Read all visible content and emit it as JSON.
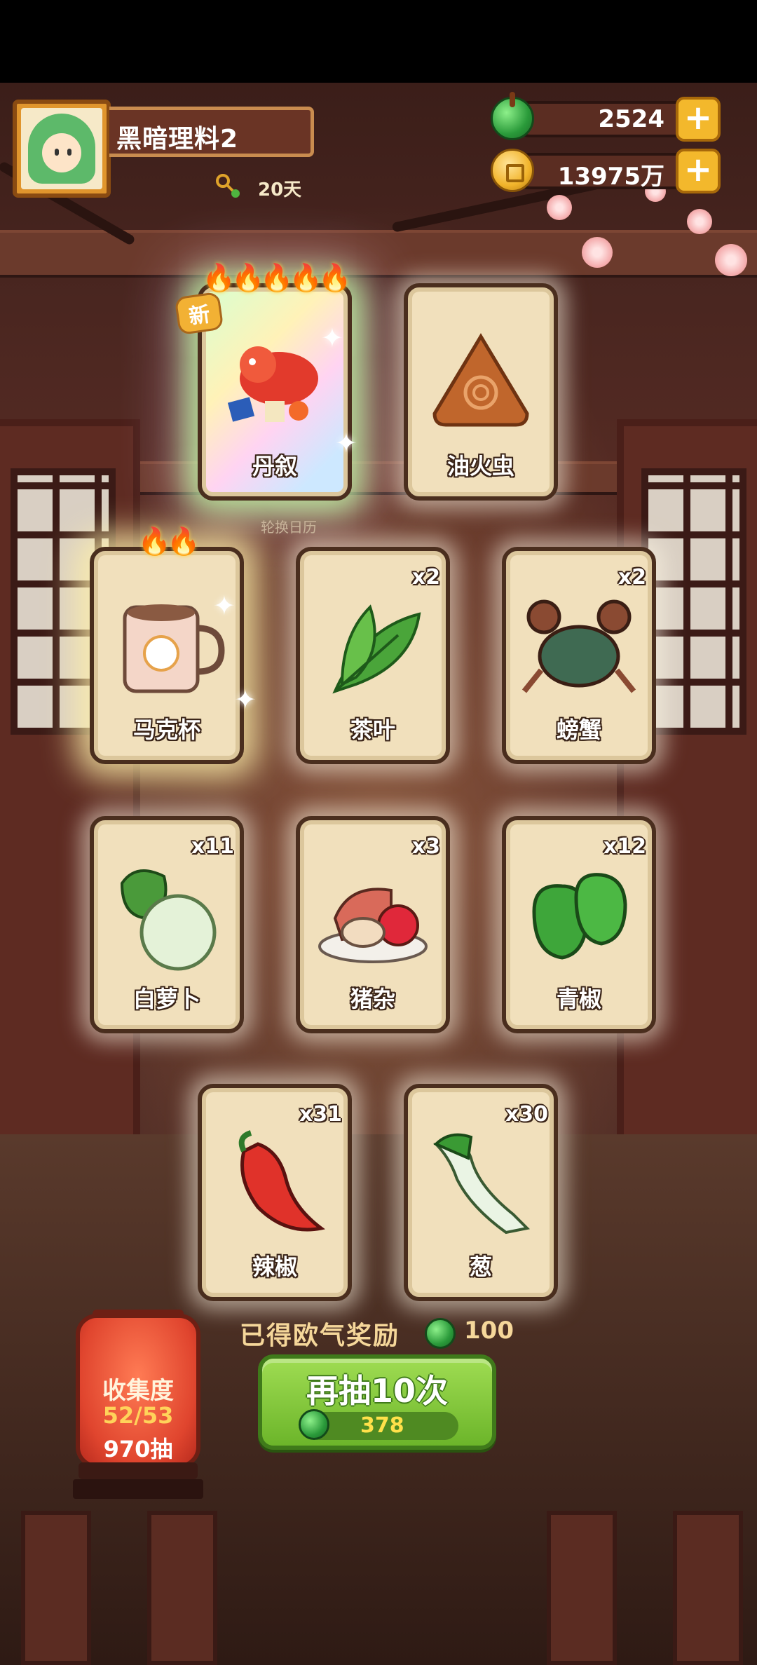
{
  "player": {
    "name": "黑暗理料2",
    "days": "20天"
  },
  "currencies": {
    "jade": "2524",
    "gold": "13975万"
  },
  "rotation_label": "轮换日历",
  "cards": [
    {
      "name": "丹叙",
      "count": "",
      "new_badge": "新",
      "flames": "🔥🔥🔥🔥🔥",
      "rarity": "rainbow"
    },
    {
      "name": "油火虫",
      "count": "",
      "rarity": "normal"
    },
    {
      "name": "马克杯",
      "count": "",
      "flames": "🔥🔥",
      "rarity": "golden"
    },
    {
      "name": "茶叶",
      "count": "x2",
      "rarity": "normal"
    },
    {
      "name": "螃蟹",
      "count": "x2",
      "rarity": "normal"
    },
    {
      "name": "白萝卜",
      "count": "x11",
      "rarity": "normal"
    },
    {
      "name": "猪杂",
      "count": "x3",
      "rarity": "normal"
    },
    {
      "name": "青椒",
      "count": "x12",
      "rarity": "normal"
    },
    {
      "name": "辣椒",
      "count": "x31",
      "rarity": "normal"
    },
    {
      "name": "葱",
      "count": "x30",
      "rarity": "normal"
    }
  ],
  "bonus": {
    "label": "已得欧气奖励",
    "value": "100"
  },
  "collection": {
    "title": "收集度",
    "progress": "52/53",
    "draws": "970抽"
  },
  "draw_button": {
    "label": "再抽10次",
    "cost": "378"
  },
  "colors": {
    "accent_green": "#6cb52a",
    "gold": "#f3b82c",
    "lantern_red": "#e0452e"
  }
}
